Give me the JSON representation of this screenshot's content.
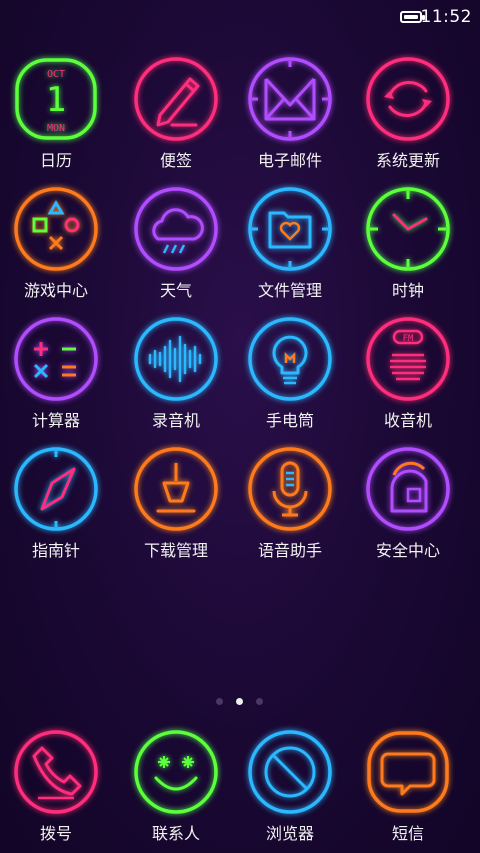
{
  "status_bar": {
    "time": "11:52",
    "battery_level": 1.0
  },
  "apps": [
    {
      "label": "日历",
      "icon": "calendar-icon",
      "month": "OCT",
      "day": "1",
      "weekday": "MON",
      "color": "#5dff3a"
    },
    {
      "label": "便签",
      "icon": "note-pencil-icon",
      "color": "#ff2d7e"
    },
    {
      "label": "电子邮件",
      "icon": "mail-envelope-icon",
      "color": "#b14dff"
    },
    {
      "label": "系统更新",
      "icon": "system-update-icon",
      "color": "#ff2d7e"
    },
    {
      "label": "游戏中心",
      "icon": "game-center-icon",
      "color": "#ff7a1c"
    },
    {
      "label": "天气",
      "icon": "weather-cloud-icon",
      "color": "#b14dff"
    },
    {
      "label": "文件管理",
      "icon": "folder-icon",
      "color": "#2bb8ff"
    },
    {
      "label": "时钟",
      "icon": "clock-icon",
      "color": "#5dff3a"
    },
    {
      "label": "计算器",
      "icon": "calculator-icon",
      "color": "#b14dff"
    },
    {
      "label": "录音机",
      "icon": "sound-wave-icon",
      "color": "#2bb8ff"
    },
    {
      "label": "手电筒",
      "icon": "lightbulb-icon",
      "color": "#2bb8ff"
    },
    {
      "label": "收音机",
      "icon": "radio-fm-icon",
      "fm_text": "FM",
      "color": "#ff2d7e"
    },
    {
      "label": "指南针",
      "icon": "compass-icon",
      "color": "#2bb8ff"
    },
    {
      "label": "下载管理",
      "icon": "download-icon",
      "color": "#ff7a1c"
    },
    {
      "label": "语音助手",
      "icon": "microphone-icon",
      "color": "#ff7a1c"
    },
    {
      "label": "安全中心",
      "icon": "security-helmet-icon",
      "color": "#b14dff"
    }
  ],
  "page_indicator": {
    "count": 3,
    "active_index": 1
  },
  "dock": [
    {
      "label": "拨号",
      "icon": "phone-icon",
      "color": "#ff2d7e"
    },
    {
      "label": "联系人",
      "icon": "contacts-smiley-icon",
      "color": "#5dff3a"
    },
    {
      "label": "浏览器",
      "icon": "browser-icon",
      "color": "#2bb8ff"
    },
    {
      "label": "短信",
      "icon": "sms-bubble-icon",
      "color": "#ff7a1c"
    }
  ]
}
